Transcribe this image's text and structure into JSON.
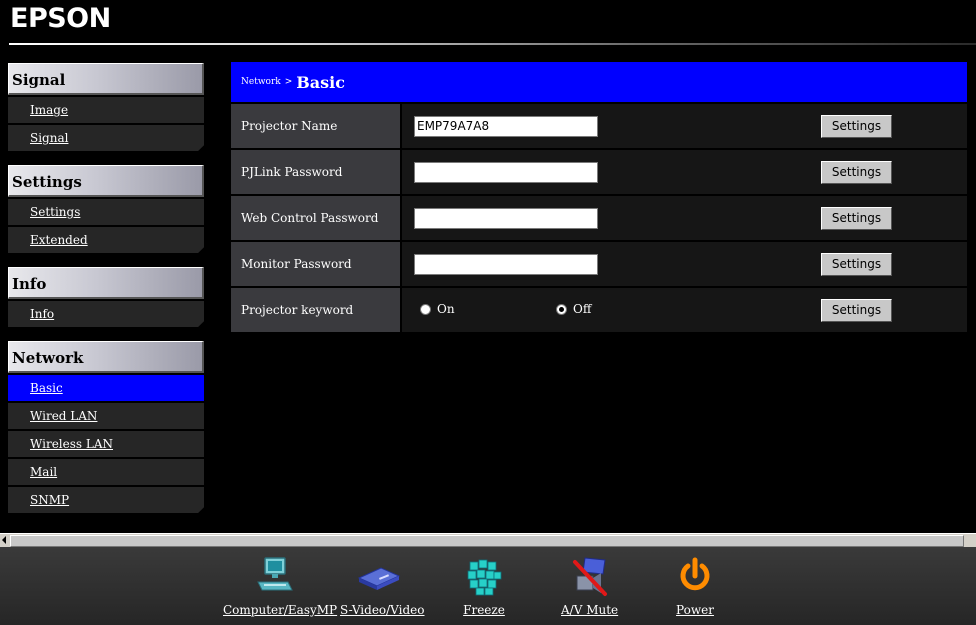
{
  "header": {
    "logo": "EPSON"
  },
  "sidebar": {
    "groups": [
      {
        "title": "Signal",
        "items": [
          "Image",
          "Signal"
        ]
      },
      {
        "title": "Settings",
        "items": [
          "Settings",
          "Extended"
        ]
      },
      {
        "title": "Info",
        "items": [
          "Info"
        ]
      },
      {
        "title": "Network",
        "items": [
          "Basic",
          "Wired LAN",
          "Wireless LAN",
          "Mail",
          "SNMP"
        ]
      }
    ],
    "active_item": "Basic"
  },
  "main": {
    "breadcrumb_parent": "Network",
    "breadcrumb_sep": ">",
    "breadcrumb_current": "Basic",
    "rows": [
      {
        "label": "Projector Name",
        "value": "EMP79A7A8",
        "button": "Settings"
      },
      {
        "label": "PJLink Password",
        "value": "",
        "button": "Settings"
      },
      {
        "label": "Web Control Password",
        "value": "",
        "button": "Settings"
      },
      {
        "label": "Monitor Password",
        "value": "",
        "button": "Settings"
      },
      {
        "label": "Projector keyword",
        "radio_on": "On",
        "radio_off": "Off",
        "selected": "Off",
        "button": "Settings"
      }
    ]
  },
  "toolbar": {
    "items": [
      {
        "label": "Computer/EasyMP",
        "icon": "computer-icon"
      },
      {
        "label": "S-Video/Video",
        "icon": "video-device-icon"
      },
      {
        "label": "Freeze",
        "icon": "freeze-icon"
      },
      {
        "label": "A/V Mute",
        "icon": "av-mute-icon"
      },
      {
        "label": "Power",
        "icon": "power-icon"
      }
    ]
  },
  "colors": {
    "accent": "#0000ff",
    "background": "#000000",
    "button": "#c8c8c8",
    "power_icon": "#ff8c00"
  }
}
